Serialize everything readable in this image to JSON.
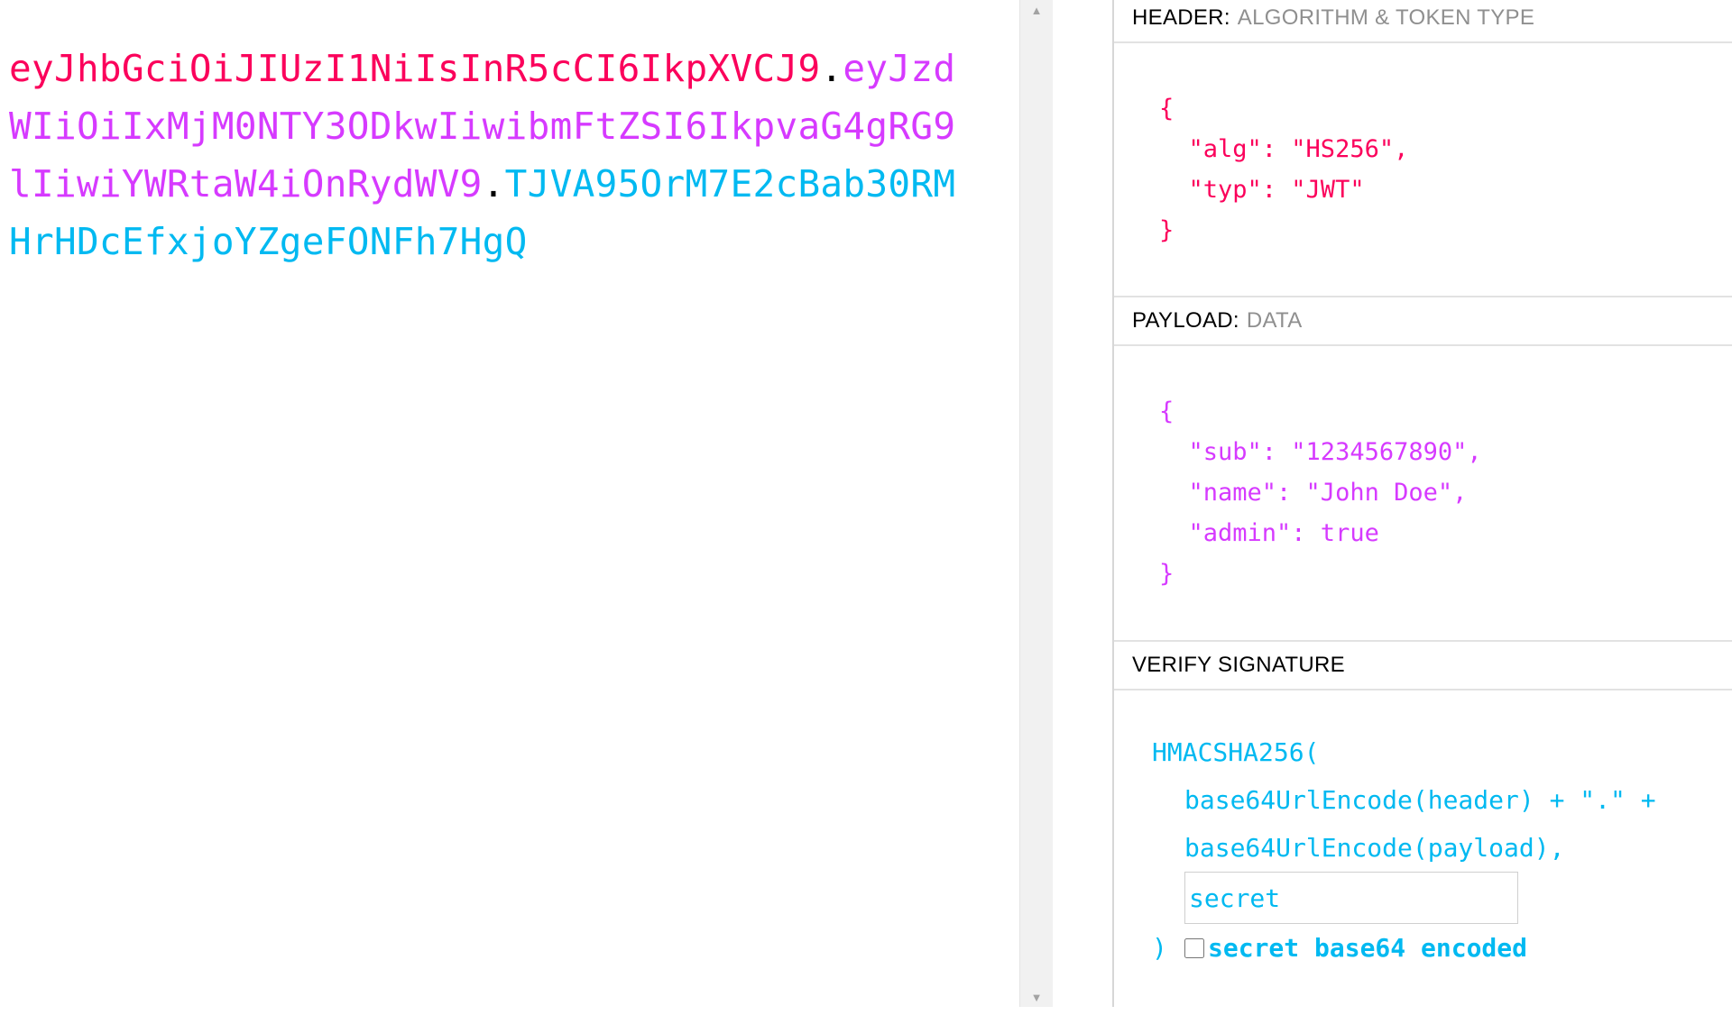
{
  "encoded": {
    "header_part": "eyJhbGciOiJIUzI1NiIsInR5cCI6IkpXVCJ9",
    "payload_part": "eyJzdWIiOiIxMjM0NTY3ODkwIiwibmFtZSI6IkpvaG4gRG9lIiwiYWRtaW4iOnRydWV9",
    "signature_part": "TJVA95OrM7E2cBab30RMHrHDcEfxjoYZgeFONFh7HgQ",
    "dot": "."
  },
  "scrollbar": {
    "up_icon": "triangle-up-icon",
    "down_icon": "triangle-down-icon",
    "up_glyph": "▲",
    "down_glyph": "▼"
  },
  "header_section": {
    "title": "HEADER:",
    "subtitle": "ALGORITHM & TOKEN TYPE",
    "json": "{\n  \"alg\": \"HS256\",\n  \"typ\": \"JWT\"\n}",
    "color": "#fb015b"
  },
  "payload_section": {
    "title": "PAYLOAD:",
    "subtitle": "DATA",
    "json": "{\n  \"sub\": \"1234567890\",\n  \"name\": \"John Doe\",\n  \"admin\": true\n}",
    "color": "#d63aff"
  },
  "signature_section": {
    "title": "VERIFY SIGNATURE",
    "line1": "HMACSHA256(",
    "line2": "base64UrlEncode(header) + \".\" +",
    "line3": "base64UrlEncode(payload),",
    "secret_value": "secret",
    "close_paren": ")",
    "checkbox_label": "secret base64 encoded",
    "checkbox_checked": false,
    "color": "#00b9f1"
  }
}
